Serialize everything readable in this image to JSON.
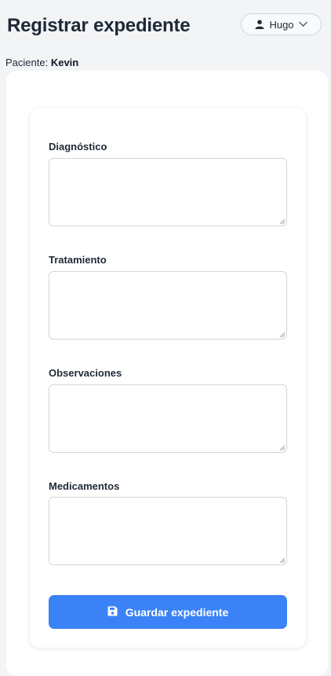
{
  "header": {
    "title": "Registrar expediente",
    "user_name": "Hugo"
  },
  "patient": {
    "label": "Paciente:",
    "name": "Kevin"
  },
  "form": {
    "fields": [
      {
        "label": "Diagnóstico",
        "value": ""
      },
      {
        "label": "Tratamiento",
        "value": ""
      },
      {
        "label": "Observaciones",
        "value": ""
      },
      {
        "label": "Medicamentos",
        "value": ""
      }
    ],
    "save_label": "Guardar expediente"
  },
  "colors": {
    "accent": "#3b82f6",
    "background": "#f3f4f6",
    "card": "#ffffff"
  },
  "icons": {
    "user": "user-icon",
    "chevron": "chevron-down-icon",
    "save": "floppy-disk-icon"
  }
}
